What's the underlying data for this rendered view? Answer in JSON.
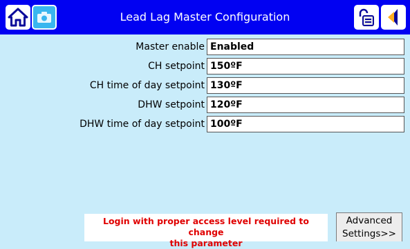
{
  "header": {
    "title": "Lead Lag Master Configuration",
    "icons": [
      "home-icon",
      "camera-icon",
      "lock-icon",
      "back-arrow-icon"
    ]
  },
  "settings": [
    {
      "label": "Master enable",
      "value": "Enabled"
    },
    {
      "label": "CH setpoint",
      "value": "150ºF"
    },
    {
      "label": "CH time of day setpoint",
      "value": "130ºF"
    },
    {
      "label": "DHW setpoint",
      "value": "120ºF"
    },
    {
      "label": "DHW time of day setpoint",
      "value": "100ºF"
    }
  ],
  "footer": {
    "login_line1": "Login with proper access level required to change",
    "login_line2": "this parameter",
    "advanced_line1": "Advanced",
    "advanced_line2": "Settings>>"
  },
  "colors": {
    "background": "#c9ecfa",
    "titlebar": "#0101f2",
    "warning_text": "#e00000"
  }
}
